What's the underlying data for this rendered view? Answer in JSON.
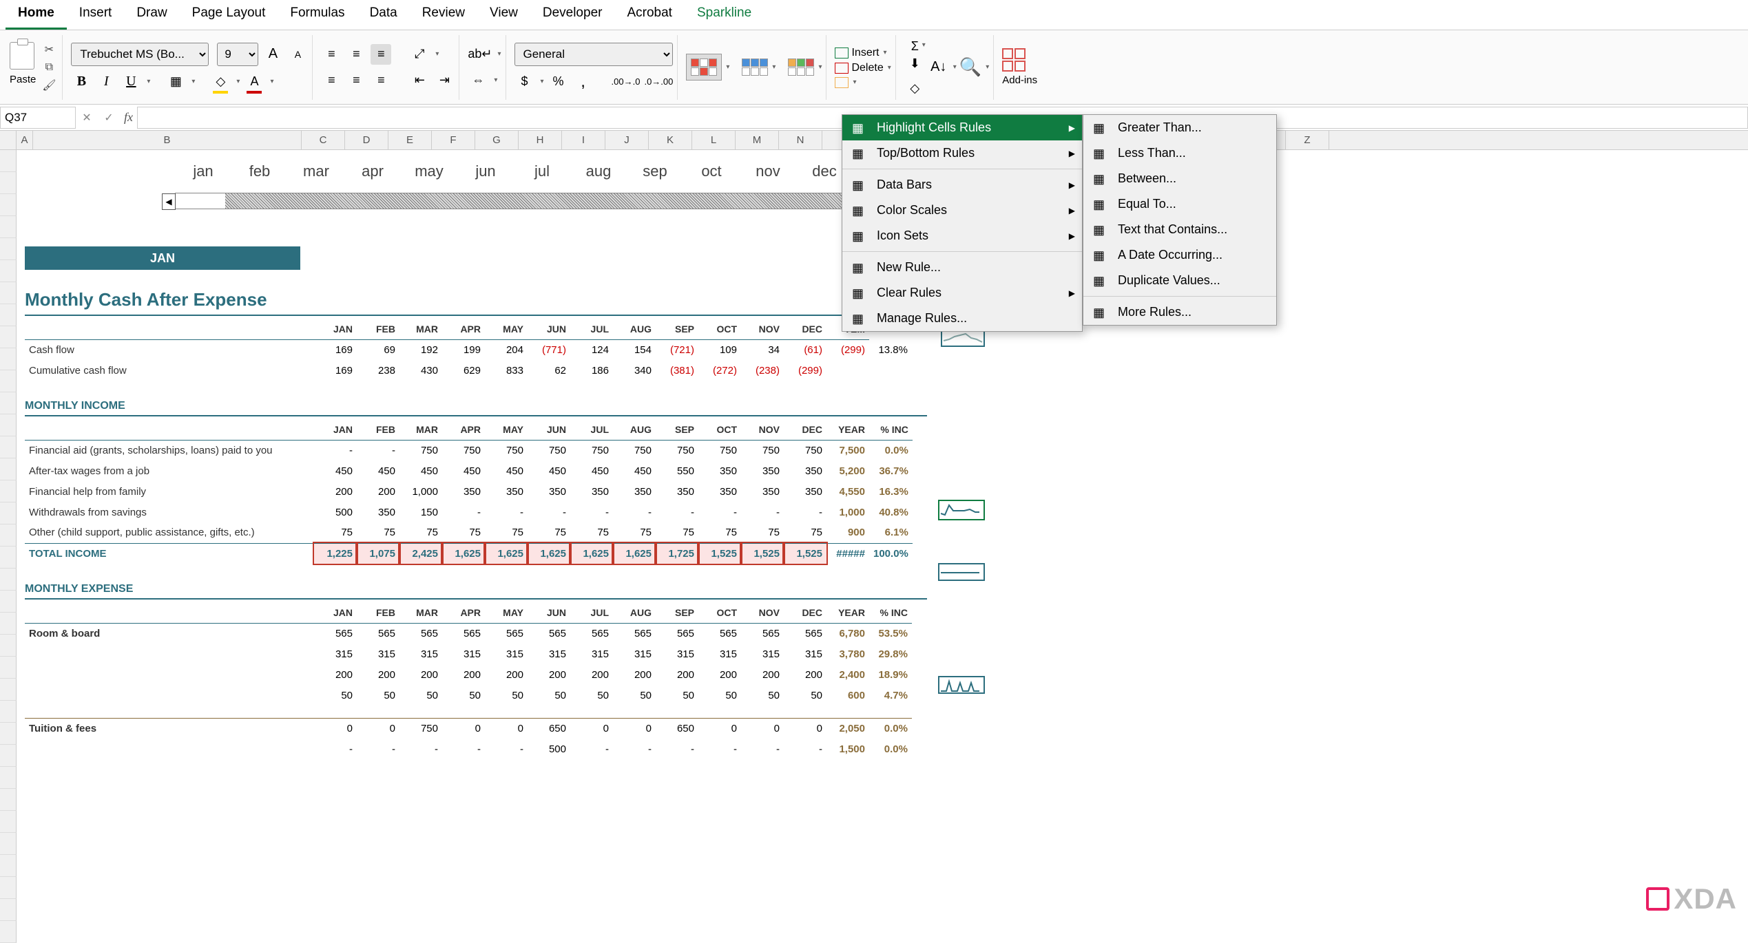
{
  "tabs": [
    "Home",
    "Insert",
    "Draw",
    "Page Layout",
    "Formulas",
    "Data",
    "Review",
    "View",
    "Developer",
    "Acrobat",
    "Sparkline"
  ],
  "ribbon": {
    "paste": "Paste",
    "font_name": "Trebuchet MS (Bo...",
    "font_size": "9",
    "number_format": "General",
    "insert_lbl": "Insert",
    "delete_lbl": "Delete",
    "addins": "Add-ins"
  },
  "formula_bar": {
    "cell_ref": "Q37",
    "fx": "fx",
    "value": ""
  },
  "columns": [
    "A",
    "B",
    "C",
    "D",
    "E",
    "F",
    "G",
    "H",
    "I",
    "J",
    "K",
    "L",
    "M",
    "N",
    "Y",
    "Z"
  ],
  "timeline_months": [
    "jan",
    "feb",
    "mar",
    "apr",
    "may",
    "jun",
    "jul",
    "aug",
    "sep",
    "oct",
    "nov",
    "dec"
  ],
  "pill": "JAN",
  "section1": {
    "title": "Monthly Cash After Expense",
    "headers": [
      "JAN",
      "FEB",
      "MAR",
      "APR",
      "MAY",
      "JUN",
      "JUL",
      "AUG",
      "SEP",
      "OCT",
      "NOV",
      "DEC",
      "YE..."
    ],
    "rows": [
      {
        "label": "Cash flow",
        "vals": [
          "169",
          "69",
          "192",
          "199",
          "204",
          "(771)",
          "124",
          "154",
          "(721)",
          "109",
          "34",
          "(61)",
          "(299)",
          "13.8%"
        ]
      },
      {
        "label": "Cumulative cash flow",
        "vals": [
          "169",
          "238",
          "430",
          "629",
          "833",
          "62",
          "186",
          "340",
          "(381)",
          "(272)",
          "(238)",
          "(299)",
          ""
        ]
      }
    ]
  },
  "section2": {
    "title": "MONTHLY INCOME",
    "headers": [
      "JAN",
      "FEB",
      "MAR",
      "APR",
      "MAY",
      "JUN",
      "JUL",
      "AUG",
      "SEP",
      "OCT",
      "NOV",
      "DEC",
      "YEAR",
      "% INC"
    ],
    "rows": [
      {
        "label": "Financial aid (grants, scholarships, loans) paid to you",
        "vals": [
          "-",
          "-",
          "750",
          "750",
          "750",
          "750",
          "750",
          "750",
          "750",
          "750",
          "750",
          "750",
          "7,500",
          "0.0%"
        ]
      },
      {
        "label": "After-tax wages from a job",
        "vals": [
          "450",
          "450",
          "450",
          "450",
          "450",
          "450",
          "450",
          "450",
          "550",
          "350",
          "350",
          "350",
          "5,200",
          "36.7%"
        ]
      },
      {
        "label": "Financial help from family",
        "vals": [
          "200",
          "200",
          "1,000",
          "350",
          "350",
          "350",
          "350",
          "350",
          "350",
          "350",
          "350",
          "350",
          "4,550",
          "16.3%"
        ]
      },
      {
        "label": "Withdrawals from savings",
        "vals": [
          "500",
          "350",
          "150",
          "-",
          "-",
          "-",
          "-",
          "-",
          "-",
          "-",
          "-",
          "-",
          "1,000",
          "40.8%"
        ]
      },
      {
        "label": "Other (child support, public assistance, gifts, etc.)",
        "vals": [
          "75",
          "75",
          "75",
          "75",
          "75",
          "75",
          "75",
          "75",
          "75",
          "75",
          "75",
          "75",
          "900",
          "6.1%"
        ]
      }
    ],
    "total": {
      "label": "TOTAL INCOME",
      "vals": [
        "1,225",
        "1,075",
        "2,425",
        "1,625",
        "1,625",
        "1,625",
        "1,625",
        "1,625",
        "1,725",
        "1,525",
        "1,525",
        "1,525",
        "#####",
        "100.0%"
      ]
    }
  },
  "section3": {
    "title": "MONTHLY EXPENSE",
    "headers": [
      "JAN",
      "FEB",
      "MAR",
      "APR",
      "MAY",
      "JUN",
      "JUL",
      "AUG",
      "SEP",
      "OCT",
      "NOV",
      "DEC",
      "YEAR",
      "% INC"
    ],
    "cat1": "Room & board",
    "rows": [
      {
        "vals": [
          "565",
          "565",
          "565",
          "565",
          "565",
          "565",
          "565",
          "565",
          "565",
          "565",
          "565",
          "565",
          "6,780",
          "53.5%"
        ]
      },
      {
        "vals": [
          "315",
          "315",
          "315",
          "315",
          "315",
          "315",
          "315",
          "315",
          "315",
          "315",
          "315",
          "315",
          "3,780",
          "29.8%"
        ]
      },
      {
        "vals": [
          "200",
          "200",
          "200",
          "200",
          "200",
          "200",
          "200",
          "200",
          "200",
          "200",
          "200",
          "200",
          "2,400",
          "18.9%"
        ]
      },
      {
        "vals": [
          "50",
          "50",
          "50",
          "50",
          "50",
          "50",
          "50",
          "50",
          "50",
          "50",
          "50",
          "50",
          "600",
          "4.7%"
        ]
      }
    ],
    "cat2": "Tuition & fees",
    "rows2": [
      {
        "vals": [
          "0",
          "0",
          "750",
          "0",
          "0",
          "650",
          "0",
          "0",
          "650",
          "0",
          "0",
          "0",
          "2,050",
          "0.0%"
        ]
      },
      {
        "vals": [
          "-",
          "-",
          "-",
          "-",
          "-",
          "500",
          "-",
          "-",
          "-",
          "-",
          "-",
          "-",
          "1,500",
          "0.0%"
        ]
      }
    ]
  },
  "menu1": [
    {
      "label": "Highlight Cells Rules",
      "arrow": true,
      "hl": true
    },
    {
      "label": "Top/Bottom Rules",
      "arrow": true
    },
    {
      "sep": true
    },
    {
      "label": "Data Bars",
      "arrow": true
    },
    {
      "label": "Color Scales",
      "arrow": true
    },
    {
      "label": "Icon Sets",
      "arrow": true
    },
    {
      "sep": true
    },
    {
      "label": "New Rule..."
    },
    {
      "label": "Clear Rules",
      "arrow": true
    },
    {
      "label": "Manage Rules..."
    }
  ],
  "menu2": [
    {
      "label": "Greater Than..."
    },
    {
      "label": "Less Than..."
    },
    {
      "label": "Between..."
    },
    {
      "label": "Equal To..."
    },
    {
      "label": "Text that Contains..."
    },
    {
      "label": "A Date Occurring..."
    },
    {
      "label": "Duplicate Values..."
    },
    {
      "sep": true
    },
    {
      "label": "More Rules..."
    }
  ],
  "watermark": "XDA"
}
